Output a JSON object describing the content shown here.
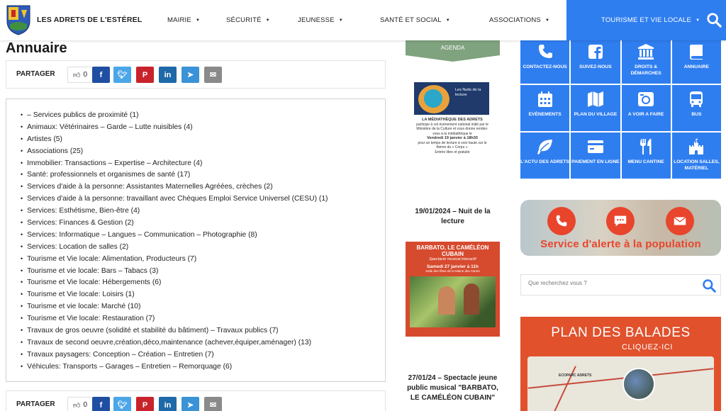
{
  "site": {
    "name": "LES ADRETS DE L'ESTÉREL"
  },
  "nav": {
    "items": [
      "MAIRIE",
      "SÉCURITÉ",
      "JEUNESSE",
      "SANTÉ ET SOCIAL",
      "ASSOCIATIONS"
    ],
    "active": "TOURISME ET VIE LOCALE",
    "accent": "#2f7ef0"
  },
  "page": {
    "title": "Annuaire"
  },
  "share": {
    "label": "PARTAGER",
    "likes": "0",
    "colors": {
      "facebook": "#1f4fa3",
      "twitter": "#4ba6e8",
      "pinterest": "#c8232c",
      "linkedin": "#1e69a8",
      "telegram": "#3a93d6",
      "email": "#8a8a8a"
    }
  },
  "directory": [
    "– Services publics de proximité (1)",
    "Animaux: Vétérinaires – Garde – Lutte nuisibles (4)",
    "Artistes (5)",
    "Associations (25)",
    "Immobilier: Transactions – Expertise – Architecture (4)",
    "Santé: professionnels et organismes de santé (17)",
    "Services d'aide à la personne: Assistantes Maternelles Agréées, crèches (2)",
    "Services d'aide à la personne: travaillant avec Chèques Emploi Service Universel (CESU) (1)",
    "Services: Esthétisme, Bien-être (4)",
    "Services: Finances & Gestion (2)",
    "Services: Informatique – Langues – Communication – Photographie (8)",
    "Services: Location de salles (2)",
    "Tourisme et Vie locale: Alimentation, Producteurs (7)",
    "Tourisme et vie locale: Bars – Tabacs (3)",
    "Tourisme et Vie locale: Hébergements (6)",
    "Tourisme et Vie locale: Loisirs (1)",
    "Tourisme et vie locale: Marché (10)",
    "Tourisme et Vie locale: Restauration (7)",
    "Travaux de gros oeuvre (solidité et stabilité du bâtiment) – Travaux publics (7)",
    "Travaux de second oeuvre,création,déco,maintenance (achever,équiper,aménager) (13)",
    "Travaux paysagers: Conception – Création – Entretien (7)",
    "Véhicules: Transports – Garages – Entretien – Remorquage (6)"
  ],
  "agenda": {
    "label": "AGENDA",
    "event1": {
      "poster_title": "Les Nuits de la lecture",
      "poster_line1": "LA MÉDIATHÈQUE DES ADRETS",
      "poster_line2": "participe à cet évènement national initié par le Ministère de la Culture et vous donne rendez-vous à la médiathèque le",
      "poster_date": "Vendredi 19 janvier à 18h30",
      "poster_line3": "pour un temps de lecture à voix haute sur le thème du « Corps ».",
      "poster_line4": "Entrée libre et gratuite",
      "caption": "19/01/2024 – Nuit de la lecture"
    },
    "event2": {
      "poster_title": "BARBATO, LE CAMÉLÉON CUBAIN",
      "poster_sub": "Spectacle musical interactif",
      "poster_date": "Samedi 27 janvier à 11h",
      "poster_place": "Salle des fêtes de la Mairie des Adrets",
      "caption": "27/01/24 – Spectacle jeune public musical \"BARBATO, LE CAMÉLÉON CUBAIN\""
    }
  },
  "quick_links": [
    {
      "label": "CONTACTEZ-NOUS",
      "icon": "phone-icon"
    },
    {
      "label": "SUIVEZ-NOUS",
      "icon": "facebook-icon"
    },
    {
      "label": "DROITS & DÉMARCHES",
      "icon": "building-icon"
    },
    {
      "label": "ANNUAIRE",
      "icon": "book-icon"
    },
    {
      "label": "EVÈNEMENTS",
      "icon": "calendar-icon"
    },
    {
      "label": "PLAN DU VILLAGE",
      "icon": "map-icon"
    },
    {
      "label": "A VOIR A FAIRE",
      "icon": "camera-icon"
    },
    {
      "label": "BUS",
      "icon": "bus-icon"
    },
    {
      "label": "L'ACTU DES ADRETS",
      "icon": "leaf-icon"
    },
    {
      "label": "PAIEMENT EN LIGNE",
      "icon": "credit-card-icon"
    },
    {
      "label": "MENU CANTINE",
      "icon": "cutlery-icon"
    },
    {
      "label": "LOCATION SALLES, MATÉRIEL",
      "icon": "castle-icon"
    }
  ],
  "alert": {
    "text": "Service d'alerte à la population",
    "color": "#e8452c"
  },
  "search": {
    "placeholder": "Que recherchez vous ?"
  },
  "balades": {
    "title": "PLAN DES BALADES",
    "subtitle": "CLIQUEZ-ICI",
    "map_label": "ECOPARC ADRETS",
    "color": "#e0512c"
  }
}
